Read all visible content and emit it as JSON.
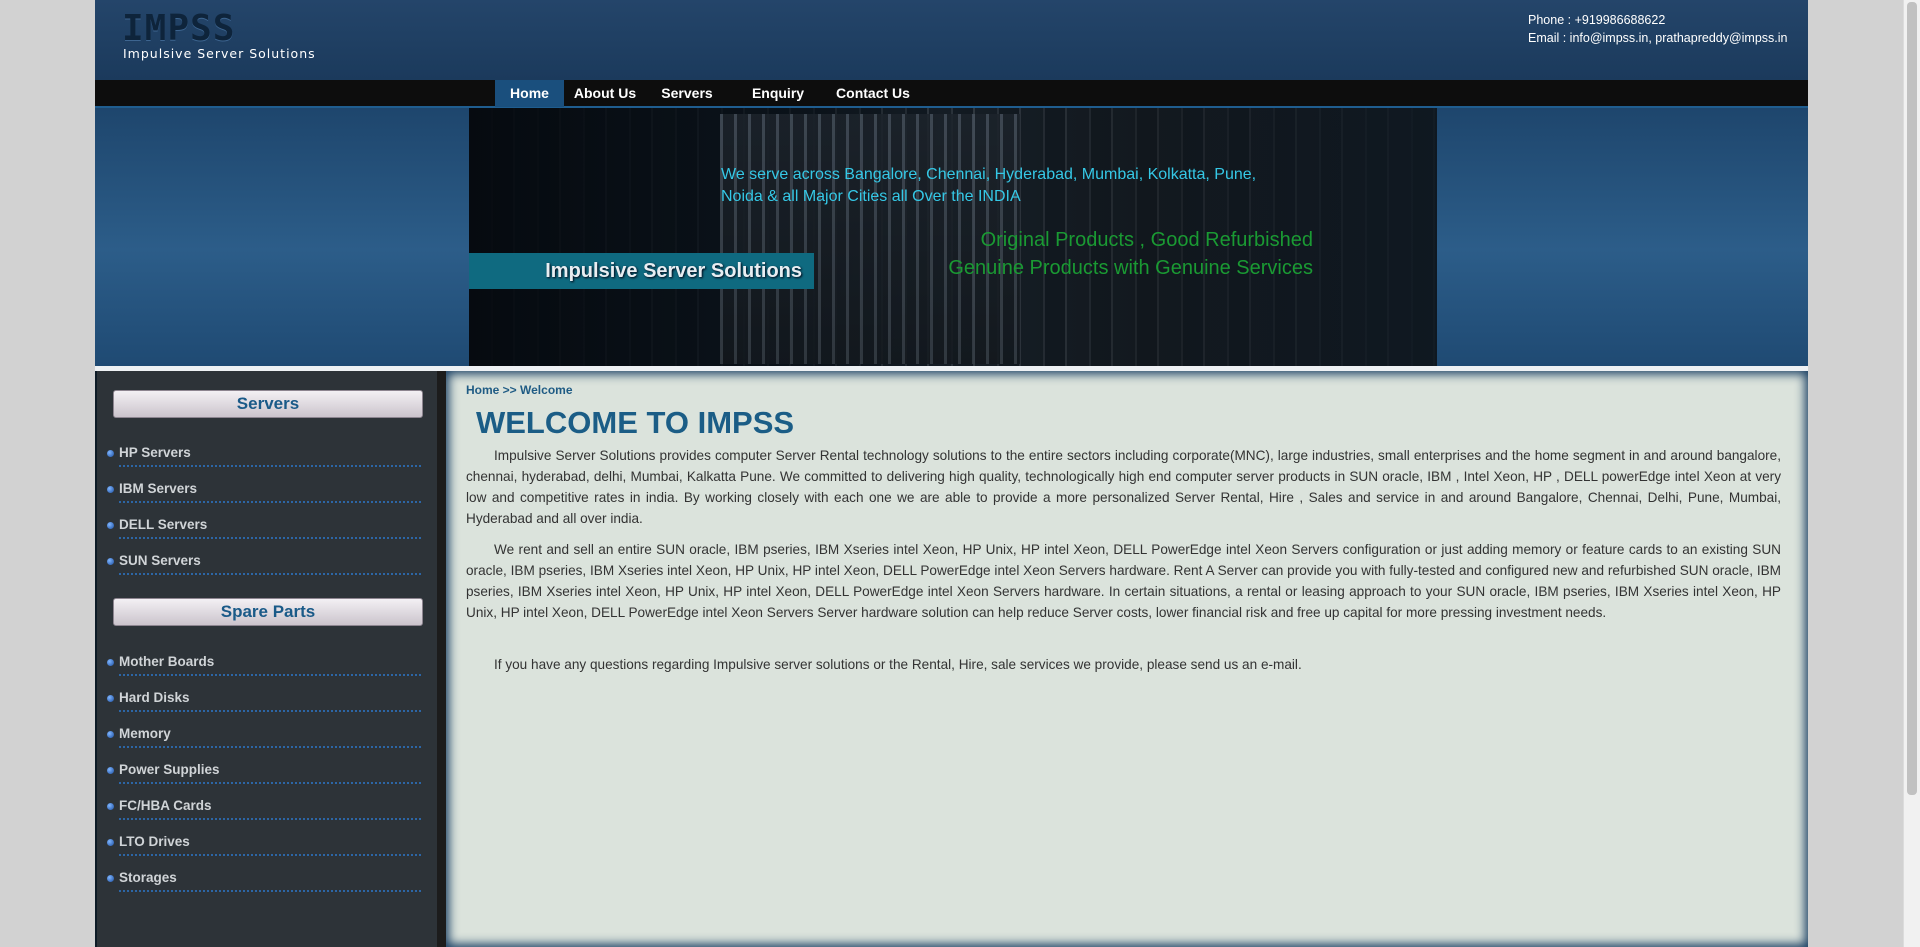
{
  "header": {
    "logo": "IMPSS",
    "logo_subtitle": "Impulsive Server Solutions",
    "phone": "Phone : +919986688622",
    "email": "Email  : info@impss.in, prathapreddy@impss.in"
  },
  "nav": {
    "items": [
      {
        "label": "Home",
        "active": true
      },
      {
        "label": "About Us"
      },
      {
        "label": "Servers"
      },
      {
        "label": "Enquiry"
      },
      {
        "label": "Contact Us"
      }
    ]
  },
  "banner": {
    "line1": "We serve across Bangalore, Chennai, Hyderabad, Mumbai, Kolkatta, Pune,",
    "line2": "Noida & all Major Cities all Over the INDIA",
    "green1": "Original Products , Good Refurbished",
    "green2": "Genuine Products with Genuine Services",
    "label": "Impulsive Server Solutions"
  },
  "sidebar": {
    "servers_heading": "Servers",
    "servers": [
      "HP Servers",
      "IBM Servers",
      "DELL Servers",
      "SUN Servers"
    ],
    "parts_heading": "Spare Parts",
    "parts": [
      "Mother Boards",
      "Hard Disks",
      "Memory",
      "Power Supplies",
      "FC/HBA Cards",
      "LTO Drives",
      "Storages"
    ]
  },
  "content": {
    "breadcrumb": "Home >> Welcome",
    "title": "WELCOME TO IMPSS",
    "para1": "Impulsive Server Solutions provides computer Server Rental technology solutions to the entire sectors including corporate(MNC), large industries, small enterprises and the home segment in and around bangalore, chennai, hyderabad, delhi, Mumbai, Kalkatta Pune. We committed to delivering high quality, technologically high end computer server products in SUN oracle, IBM , Intel Xeon, HP , DELL powerEdge intel Xeon at very low and competitive rates in india. By working closely with each one we are able to provide a more personalized Server Rental, Hire , Sales and service in and around Bangalore, Chennai, Delhi, Pune, Mumbai, Hyderabad and all over india.",
    "para2": "We rent and sell an entire SUN oracle, IBM pseries, IBM Xseries intel Xeon, HP Unix, HP intel Xeon, DELL PowerEdge intel Xeon Servers configuration or just adding memory or feature cards to an existing SUN oracle, IBM pseries, IBM Xseries intel Xeon, HP Unix, HP intel Xeon, DELL PowerEdge intel Xeon Servers hardware. Rent A Server can provide you with fully-tested and configured new and refurbished SUN oracle, IBM pseries, IBM Xseries intel Xeon, HP Unix, HP intel Xeon, DELL PowerEdge intel Xeon Servers hardware. In certain situations, a rental or leasing approach to your SUN oracle, IBM pseries, IBM Xseries intel Xeon, HP Unix, HP intel Xeon, DELL PowerEdge intel Xeon Servers Server hardware solution can help reduce Server costs, lower financial risk and free up capital for more pressing investment needs.",
    "para3": "If you have any questions regarding Impulsive server solutions or the Rental, Hire, sale services we provide, please send us an e-mail."
  }
}
